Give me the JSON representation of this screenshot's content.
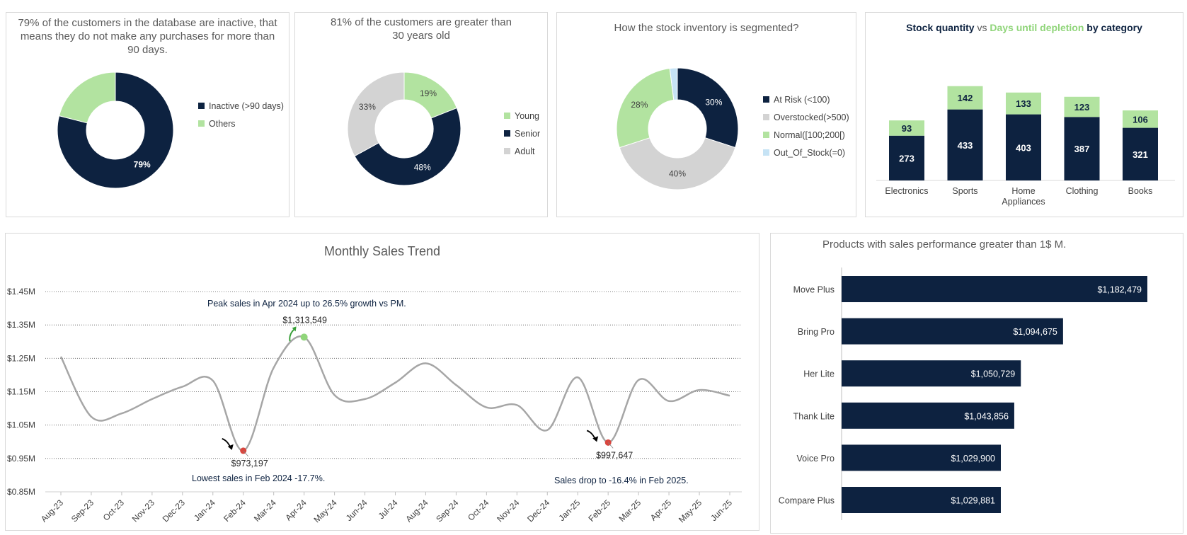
{
  "colors": {
    "navy": "#0d2240",
    "green": "#b2e3a0",
    "gray": "#d3d3d3",
    "lightblue": "#c6e3f5",
    "line": "#a6a6a6",
    "red": "#d9463e",
    "peak": "#90d57a"
  },
  "inactive_chart": {
    "title": "79% of the customers in the database are inactive, that means they do not make any purchases for more than 90 days.",
    "chart_data": {
      "type": "pie",
      "categories": [
        "Inactive (>90 days)",
        "Others"
      ],
      "values": [
        79,
        21
      ],
      "labels": [
        "79%",
        ""
      ],
      "colors": [
        "#0d2240",
        "#b2e3a0"
      ]
    }
  },
  "age_chart": {
    "title": "81% of the customers are greater than 30 years old",
    "chart_data": {
      "type": "pie",
      "categories": [
        "Young",
        "Senior",
        "Adult"
      ],
      "values": [
        19,
        48,
        33
      ],
      "labels": [
        "19%",
        "48%",
        "33%"
      ],
      "colors": [
        "#b2e3a0",
        "#0d2240",
        "#d3d3d3"
      ]
    }
  },
  "stock_segment_chart": {
    "title": "How the stock inventory is segmented?",
    "chart_data": {
      "type": "pie",
      "categories": [
        "At Risk (<100)",
        "Overstocked(>500)",
        "Normal([100;200[)",
        "Out_Of_Stock(=0)"
      ],
      "values": [
        30,
        40,
        28,
        2
      ],
      "labels": [
        "30%",
        "40%",
        "28%",
        ""
      ],
      "colors": [
        "#0d2240",
        "#d3d3d3",
        "#b2e3a0",
        "#c6e3f5"
      ]
    }
  },
  "stock_days_chart": {
    "title_part1": "Stock quantity",
    "title_part2": " vs ",
    "title_part3": "Days until depletion",
    "title_part4": " by category",
    "chart_data": {
      "type": "bar",
      "stacked": true,
      "categories": [
        "Electronics",
        "Sports",
        "Home Appliances",
        "Clothing",
        "Books"
      ],
      "series": [
        {
          "name": "Stock quantity",
          "values": [
            273,
            433,
            403,
            387,
            321
          ],
          "color": "#0d2240"
        },
        {
          "name": "Days until depletion",
          "values": [
            93,
            142,
            133,
            123,
            106
          ],
          "color": "#b2e3a0"
        }
      ]
    }
  },
  "monthly_trend": {
    "title": "Monthly Sales Trend",
    "peak_note": "Peak sales in Apr 2024 up to  26.5% growth vs PM.",
    "low_note": "Lowest sales in Feb 2024 -17.7%.",
    "drop_note": "Sales drop to -16.4% in Feb 2025.",
    "peak_label": "$1,313,549",
    "low_label": "$973,197",
    "drop_label": "$997,647",
    "chart_data": {
      "type": "line",
      "x": [
        "Aug-23",
        "Sep-23",
        "Oct-23",
        "Nov-23",
        "Dec-23",
        "Jan-24",
        "Feb-24",
        "Mar-24",
        "Apr-24",
        "May-24",
        "Jun-24",
        "Jul-24",
        "Aug-24",
        "Sep-24",
        "Oct-24",
        "Nov-24",
        "Dec-24",
        "Jan-25",
        "Feb-25",
        "Mar-25",
        "Apr-25",
        "May-25",
        "Jun-25"
      ],
      "values": [
        1255000,
        1075000,
        1085000,
        1128000,
        1165000,
        1183000,
        973197,
        1222000,
        1313549,
        1140000,
        1128000,
        1177000,
        1235000,
        1170000,
        1103000,
        1110000,
        1035000,
        1193000,
        997647,
        1185000,
        1122000,
        1155000,
        1138000
      ],
      "yticks": [
        "$0.85M",
        "$0.95M",
        "$1.05M",
        "$1.15M",
        "$1.25M",
        "$1.35M",
        "$1.45M"
      ],
      "ylim": [
        850000,
        1450000
      ],
      "grid": true,
      "highlights": {
        "peak_index": 8,
        "low_index": 6,
        "drop_index": 18
      }
    }
  },
  "top_products": {
    "title": "Products with sales performance greater than 1$ M.",
    "chart_data": {
      "type": "bar",
      "orientation": "horizontal",
      "categories": [
        "Move Plus",
        "Bring Pro",
        "Her Lite",
        "Thank Lite",
        "Voice Pro",
        "Compare Plus"
      ],
      "values": [
        1182479,
        1094675,
        1050729,
        1043856,
        1029900,
        1029881
      ],
      "labels": [
        "$1,182,479",
        "$1,094,675",
        "$1,050,729",
        "$1,043,856",
        "$1,029,900",
        "$1,029,881"
      ],
      "color": "#0d2240"
    }
  }
}
